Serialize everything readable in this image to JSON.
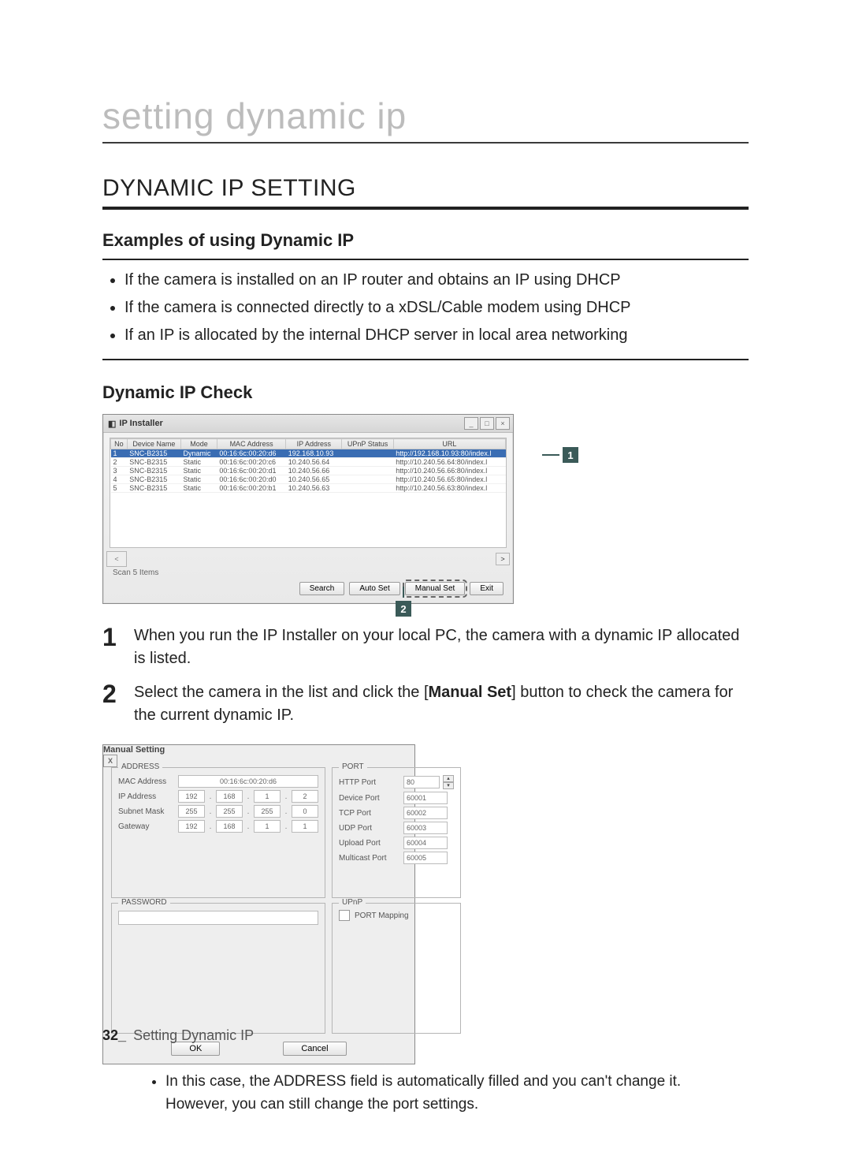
{
  "header": {
    "stylized": "setting dynamic ip",
    "section": "DYNAMIC IP SETTING",
    "sub_examples": "Examples of using Dynamic IP",
    "sub_check": "Dynamic IP Check"
  },
  "bullets": {
    "b1": "If the camera is installed on an IP router and obtains an IP using DHCP",
    "b2": "If the camera is connected directly to a xDSL/Cable modem using DHCP",
    "b3": "If an IP is allocated by the internal DHCP server in local area networking"
  },
  "callouts": {
    "c1": "1",
    "c2": "2"
  },
  "installer": {
    "title": "IP Installer",
    "columns": {
      "no": "No",
      "device": "Device Name",
      "mode": "Mode",
      "mac": "MAC Address",
      "ip": "IP Address",
      "upnp": "UPnP Status",
      "url": "URL"
    },
    "rows": [
      {
        "no": "1",
        "device": "SNC-B2315",
        "mode": "Dynamic",
        "mac": "00:16:6c:00:20:d6",
        "ip": "192.168.10.93",
        "upnp": "",
        "url": "http://192.168.10.93:80/index.l"
      },
      {
        "no": "2",
        "device": "SNC-B2315",
        "mode": "Static",
        "mac": "00:16:6c:00:20:c6",
        "ip": "10.240.56.64",
        "upnp": "",
        "url": "http://10.240.56.64:80/index.l"
      },
      {
        "no": "3",
        "device": "SNC-B2315",
        "mode": "Static",
        "mac": "00:16:6c:00:20:d1",
        "ip": "10.240.56.66",
        "upnp": "",
        "url": "http://10.240.56.66:80/index.l"
      },
      {
        "no": "4",
        "device": "SNC-B2315",
        "mode": "Static",
        "mac": "00:16:6c:00:20:d0",
        "ip": "10.240.56.65",
        "upnp": "",
        "url": "http://10.240.56.65:80/index.l"
      },
      {
        "no": "5",
        "device": "SNC-B2315",
        "mode": "Static",
        "mac": "00:16:6c:00:20:b1",
        "ip": "10.240.56.63",
        "upnp": "",
        "url": "http://10.240.56.63:80/index.l"
      }
    ],
    "scancount": "Scan 5 Items",
    "scroll_left": "<",
    "scroll_right": ">",
    "btn_search": "Search",
    "btn_autoset": "Auto Set",
    "btn_manualset": "Manual Set",
    "btn_exit": "Exit"
  },
  "steps": {
    "n1": "1",
    "t1": "When you run the IP Installer on your local PC, the camera with a dynamic IP allocated is listed.",
    "n2": "2",
    "t2a": "Select the camera in the list and click the [",
    "t2b": "Manual Set",
    "t2c": "] button to check the camera for the current dynamic IP."
  },
  "manual": {
    "title": "Manual Setting",
    "grp_address": "ADDRESS",
    "grp_password": "PASSWORD",
    "grp_port": "PORT",
    "grp_upnp": "UPnP",
    "lbl_mac": "MAC Address",
    "lbl_ip": "IP Address",
    "lbl_subnet": "Subnet Mask",
    "lbl_gateway": "Gateway",
    "val_mac": "00:16:6c:00:20:d6",
    "ip": [
      "192",
      "168",
      "1",
      "2"
    ],
    "sm": [
      "255",
      "255",
      "255",
      "0"
    ],
    "gw": [
      "192",
      "168",
      "1",
      "1"
    ],
    "lbl_http": "HTTP Port",
    "lbl_device": "Device Port",
    "lbl_tcp": "TCP Port",
    "lbl_udp": "UDP Port",
    "lbl_upload": "Upload Port",
    "lbl_multicast": "Multicast Port",
    "val_http": "80",
    "val_device": "60001",
    "val_tcp": "60002",
    "val_udp": "60003",
    "val_upload": "60004",
    "val_multicast": "60005",
    "lbl_portmap": "PORT Mapping",
    "btn_ok": "OK",
    "btn_cancel": "Cancel",
    "close_x": "X"
  },
  "note": {
    "line1": "In this case, the ADDRESS field is automatically filled and you can't change it.",
    "line2": "However, you can still change the port settings."
  },
  "footer": {
    "pageno": "32_",
    "text": "Setting Dynamic IP"
  }
}
